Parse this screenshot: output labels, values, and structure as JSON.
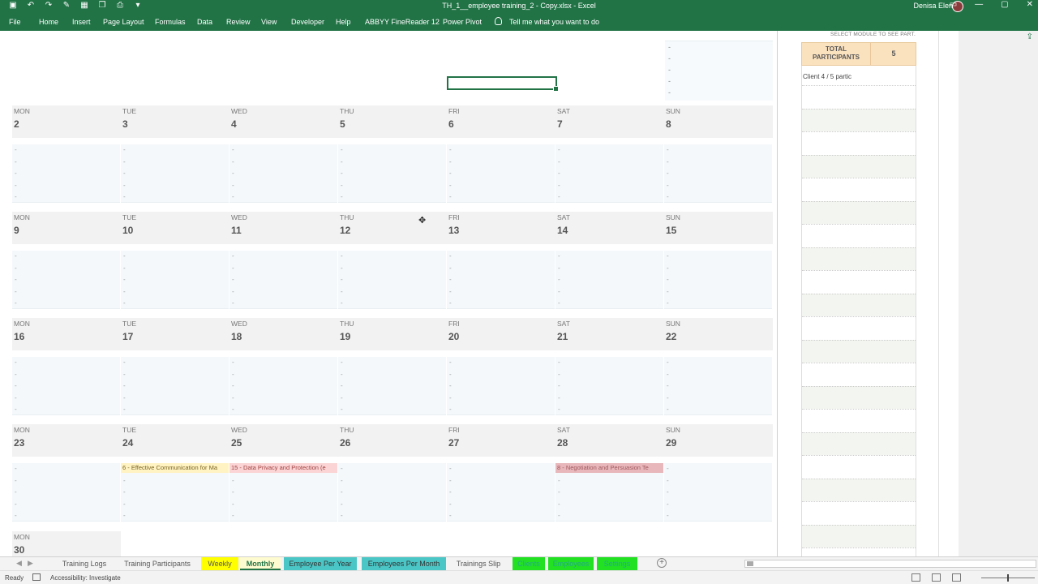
{
  "titlebar": {
    "doc_title": "TH_1__employee training_2 - Copy.xlsx  -  Excel",
    "user": "Denisa Elena",
    "qat_icons": [
      "save-icon",
      "undo-icon",
      "redo-icon",
      "format-icon",
      "table-icon",
      "copy-icon",
      "print-icon",
      "more-icon"
    ],
    "controls": [
      "ribbon-options-icon",
      "minimize-icon",
      "restore-icon",
      "close-icon"
    ]
  },
  "ribbon": {
    "tabs": [
      "File",
      "Home",
      "Insert",
      "Page Layout",
      "Formulas",
      "Data",
      "Review",
      "View",
      "Developer",
      "Help",
      "ABBYY FineReader 12",
      "Power Pivot"
    ],
    "tell_me": "Tell me what you want to do"
  },
  "calendar": {
    "day_names": [
      "MON",
      "TUE",
      "WED",
      "THU",
      "FRI",
      "SAT",
      "SUN"
    ],
    "weeks": [
      {
        "days": [
          "2",
          "3",
          "4",
          "5",
          "6",
          "7",
          "8"
        ]
      },
      {
        "days": [
          "9",
          "10",
          "11",
          "12",
          "13",
          "14",
          "15"
        ]
      },
      {
        "days": [
          "16",
          "17",
          "18",
          "19",
          "20",
          "21",
          "22"
        ]
      },
      {
        "days": [
          "23",
          "24",
          "25",
          "26",
          "27",
          "28",
          "29"
        ]
      }
    ],
    "partial": {
      "day_name": "MON",
      "day_num": "30"
    },
    "dash": "-",
    "events": {
      "tue24": "6 - Effective Communication for Ma",
      "wed25": "15 - Data Privacy and Protection (e",
      "sat28": "8 - Negotiation and Persuasion Te"
    }
  },
  "panel": {
    "caption": "SELECT MODULE TO SEE PART.",
    "total_label": "TOTAL PARTICIPANTS",
    "total_value": "5",
    "client_line": "Client 4 / 5 partic"
  },
  "sheet_tabs": [
    "Training Logs",
    "Training Participants",
    "Weekly",
    "Monthly",
    "Employee Per Year",
    "Employees Per Month",
    "Trainings Slip",
    "Clients",
    "Employees",
    "Settings"
  ],
  "status": {
    "ready": "Ready",
    "accessibility": "Accessibility: Investigate"
  },
  "colors": {
    "excel_green": "#217346",
    "event_yellow": "#fff3c4",
    "event_pink": "#fbd5d5",
    "event_rose": "#e8b7bb",
    "total_box": "#fbe2bf",
    "tab_yellow": "#ffff00",
    "tab_teal": "#4bc6c6",
    "tab_green": "#22e022"
  }
}
